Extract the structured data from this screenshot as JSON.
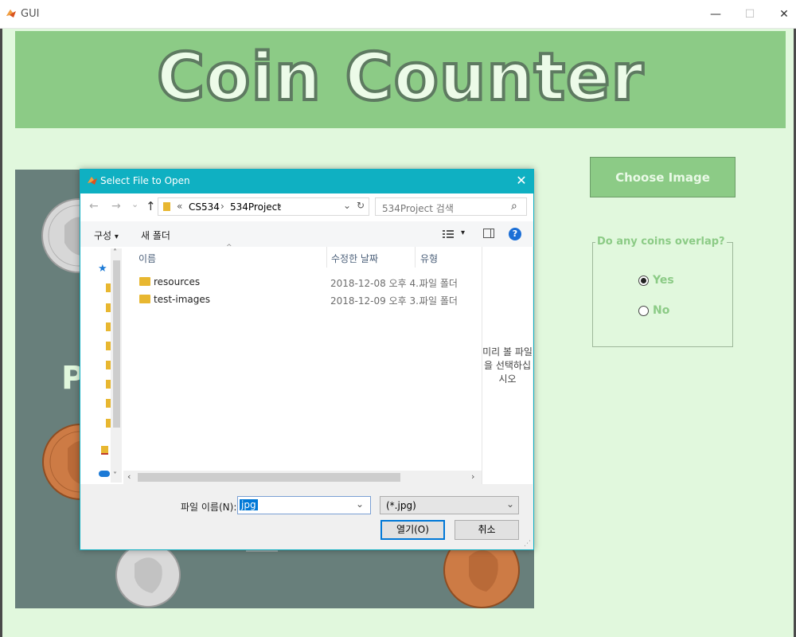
{
  "window": {
    "title": "GUI",
    "minimize": "—",
    "maximize": "☐",
    "close": "✕"
  },
  "app": {
    "title": "Coin Counter",
    "choose_button": "Choose Image",
    "overlap_question": "Do any coins overlap?",
    "overlap_options": [
      {
        "label": "Yes",
        "selected": true
      },
      {
        "label": "No",
        "selected": false
      }
    ],
    "panel_letter": "P"
  },
  "dialog": {
    "title": "Select File to Open",
    "close": "✕",
    "nav": {
      "back": "←",
      "forward": "→",
      "recent": "⌄",
      "up": "↑"
    },
    "address": {
      "prefix": "«",
      "crumbs": [
        "CS534",
        "534Project"
      ],
      "separator": "›",
      "dropdown": "⌄",
      "refresh": "↻"
    },
    "search_placeholder": "534Project 검색",
    "search_icon": "⌕",
    "toolbar": {
      "organize": "구성",
      "organize_arrow": "▾",
      "new_folder": "새 폴더",
      "view_arrow": "▾",
      "help": "?"
    },
    "columns": {
      "name": "이름",
      "date": "수정한 날짜",
      "type": "유형"
    },
    "files": [
      {
        "name": "resources",
        "date": "2018-12-08 오후 4...",
        "type": "파일 폴더"
      },
      {
        "name": "test-images",
        "date": "2018-12-09 오후 3...",
        "type": "파일 폴더"
      }
    ],
    "preview_text": "미리 볼 파일을 선택하십시오",
    "filename_label": "파일 이름(N):",
    "filename_value": "jpg",
    "filename_arrow": "⌄",
    "filter": "(*.jpg)",
    "filter_arrow": "⌄",
    "open_button": "열기(O)",
    "cancel_button": "취소"
  },
  "colors": {
    "header_green": "#8ccb86",
    "background": "#e1f8dd",
    "image_panel": "#687f7b",
    "dialog_accent": "#0fb0c2",
    "copper": "#cd7b45",
    "silver": "#d2d2d2"
  }
}
